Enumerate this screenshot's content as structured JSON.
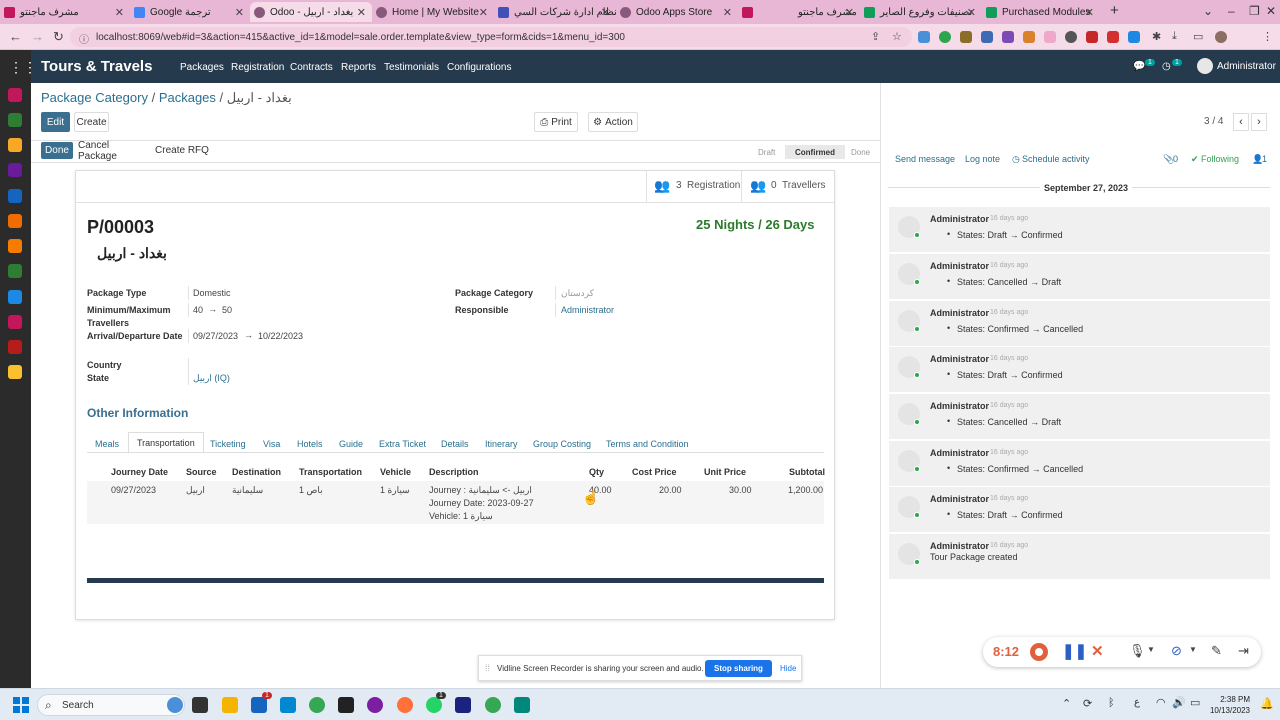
{
  "browser": {
    "tabs": [
      {
        "title": "مشرف ماجنتو"
      },
      {
        "title": "Google ترجمة"
      },
      {
        "title": "Odoo - بغداد - اربيل"
      },
      {
        "title": "Home | My Website"
      },
      {
        "title": "نظام ادارة شركات السي"
      },
      {
        "title": "Odoo Apps Store"
      },
      {
        "title": "مشرف ماجنتو"
      },
      {
        "title": "تصنيفات وفروع الصاير"
      },
      {
        "title": "Purchased Modules"
      }
    ],
    "url": "localhost:8069/web#id=3&action=415&active_id=1&model=sale.order.template&view_type=form&cids=1&menu_id=300"
  },
  "navbar": {
    "app_name": "Tours & Travels",
    "menu": [
      "Packages",
      "Registration",
      "Contracts",
      "Reports",
      "Testimonials",
      "Configurations"
    ],
    "messages_count": "1",
    "activities_count": "1",
    "user": "Administrator"
  },
  "breadcrumb": {
    "level1": "Package Category",
    "level2": "Packages",
    "current": "بغداد - اربيل"
  },
  "control": {
    "edit": "Edit",
    "create": "Create",
    "print": "Print",
    "action": "Action",
    "pager": "3 / 4"
  },
  "header_buttons": {
    "done": "Done",
    "cancel_package": "Cancel Package",
    "create_rfq": "Create RFQ"
  },
  "stages": [
    "Draft",
    "Confirmed",
    "Done"
  ],
  "smart_buttons": {
    "registration_count": "3",
    "registration_label": "Registration",
    "travellers_count": "0",
    "travellers_label": "Travellers"
  },
  "form": {
    "reference": "P/00003",
    "name": "بغداد - اربيل",
    "duration": "25 Nights / 26 Days",
    "labels": {
      "package_type": "Package Type",
      "min_max": "Minimum/Maximum",
      "min_max2": "Travellers",
      "arrival_departure": "Arrival/Departure Date",
      "country": "Country",
      "state": "State",
      "package_category": "Package Category",
      "responsible": "Responsible"
    },
    "package_type": "Domestic",
    "min_travellers": "40",
    "max_travellers": "50",
    "arrival_date": "09/27/2023",
    "departure_date": "10/22/2023",
    "arrow": "→",
    "country": "",
    "state": "اربيل (IQ)",
    "package_category": "كردستان",
    "responsible": "Administrator",
    "other_information": "Other Information"
  },
  "notebook_tabs": [
    "Meals",
    "Transportation",
    "Ticketing",
    "Visa",
    "Hotels",
    "Guide",
    "Extra Ticket",
    "Details",
    "Itinerary",
    "Group Costing",
    "Terms and Condition"
  ],
  "transport_table": {
    "headers": [
      "Journey Date",
      "Source",
      "Destination",
      "Transportation",
      "Vehicle",
      "Description",
      "Qty",
      "Cost Price",
      "Unit Price",
      "Subtotal"
    ],
    "rows": [
      {
        "journey_date": "09/27/2023",
        "source": "اربيل",
        "destination": "سليمانية",
        "transportation": "باص 1",
        "vehicle": "سيارة 1",
        "desc_line1": "Journey : اربيل -> سليمانية",
        "desc_line2": "Journey Date: 2023-09-27",
        "desc_line3": "Vehicle: سيارة 1",
        "qty": "40.00",
        "cost_price": "20.00",
        "unit_price": "30.00",
        "subtotal": "1,200.00"
      }
    ]
  },
  "chatter": {
    "send_message": "Send message",
    "log_note": "Log note",
    "schedule_activity": "Schedule activity",
    "attachments": "0",
    "following": "Following",
    "followers": "1",
    "date": "September 27, 2023",
    "messages": [
      {
        "author": "Administrator",
        "ago": "16 days ago",
        "from": "Draft",
        "to": "Confirmed"
      },
      {
        "author": "Administrator",
        "ago": "16 days ago",
        "from": "Cancelled",
        "to": "Draft"
      },
      {
        "author": "Administrator",
        "ago": "16 days ago",
        "from": "Confirmed",
        "to": "Cancelled"
      },
      {
        "author": "Administrator",
        "ago": "16 days ago",
        "from": "Draft",
        "to": "Confirmed"
      },
      {
        "author": "Administrator",
        "ago": "16 days ago",
        "from": "Cancelled",
        "to": "Draft"
      },
      {
        "author": "Administrator",
        "ago": "16 days ago",
        "from": "Confirmed",
        "to": "Cancelled"
      },
      {
        "author": "Administrator",
        "ago": "16 days ago",
        "from": "Draft",
        "to": "Confirmed"
      }
    ],
    "states_label": "States:",
    "state_arrow": "→",
    "created_author": "Administrator",
    "created_ago": "16 days ago",
    "created_text": "Tour Package created"
  },
  "recorder": {
    "time": "8:12"
  },
  "screen_share": {
    "text": "Vidline Screen Recorder is sharing your screen and audio.",
    "stop": "Stop sharing",
    "hide": "Hide"
  },
  "taskbar": {
    "search": "Search",
    "time": "2:38 PM",
    "date": "10/13/2023",
    "badge": "1"
  }
}
